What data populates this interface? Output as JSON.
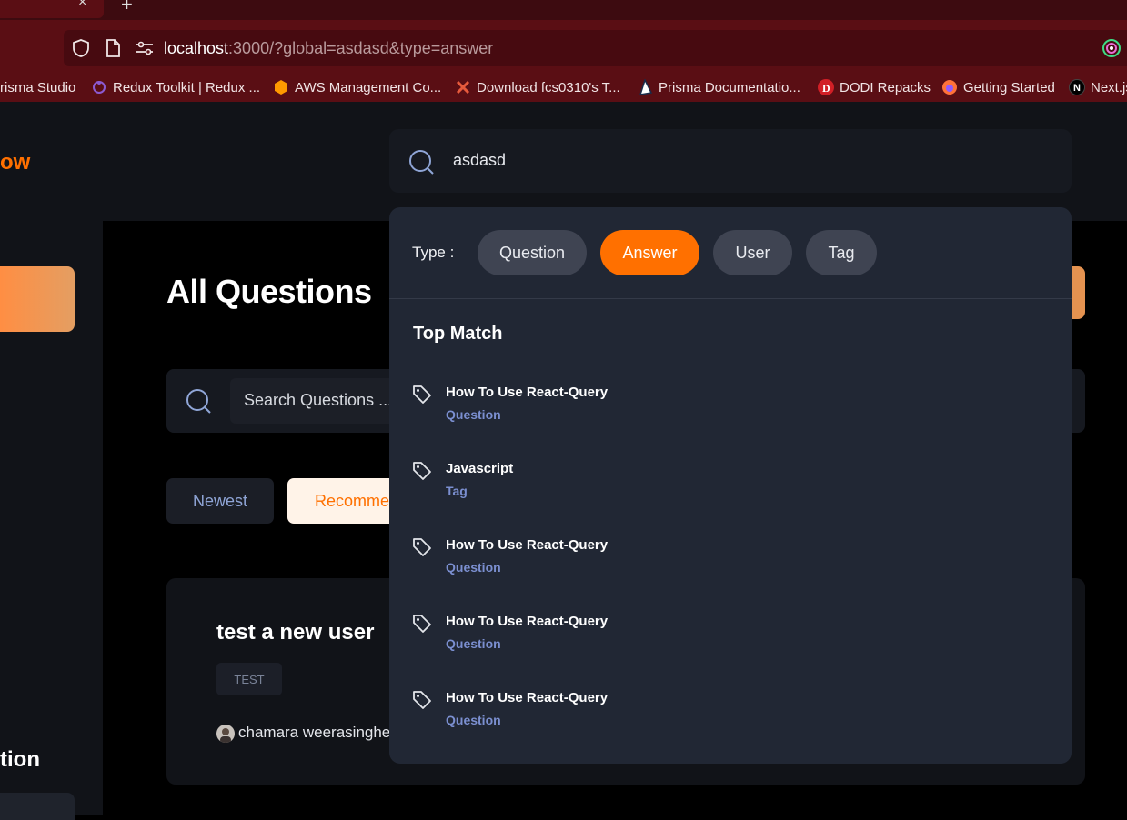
{
  "browser": {
    "tab_close": "×",
    "tab_new": "+",
    "url_host": "localhost",
    "url_rest": ":3000/?global=asdasd&type=answer",
    "bookmarks": [
      {
        "label": "risma Studio",
        "icon": "prisma-icon"
      },
      {
        "label": "Redux Toolkit | Redux ...",
        "icon": "redux-icon"
      },
      {
        "label": "AWS Management Co...",
        "icon": "aws-icon"
      },
      {
        "label": "Download fcs0310's T...",
        "icon": "x-icon"
      },
      {
        "label": "Prisma Documentatio...",
        "icon": "prisma-triangle-icon"
      },
      {
        "label": "DODI Repacks",
        "icon": "dodi-icon"
      },
      {
        "label": "Getting Started",
        "icon": "firefox-icon"
      },
      {
        "label": "Next.js",
        "icon": "nextjs-icon"
      }
    ]
  },
  "header": {
    "logo_fragment": "ow",
    "global_search_value": "asdasd"
  },
  "sidebar": {
    "bottom_fragment": "tion"
  },
  "main": {
    "title": "All Questions",
    "search_placeholder": "Search Questions ...",
    "filters": [
      "Newest",
      "Recommended"
    ],
    "question": {
      "title": "test a new user",
      "tag": "TEST",
      "author": "chamara weerasinghe"
    }
  },
  "dropdown": {
    "type_label": "Type :",
    "types": [
      {
        "label": "Question",
        "active": false
      },
      {
        "label": "Answer",
        "active": true
      },
      {
        "label": "User",
        "active": false
      },
      {
        "label": "Tag",
        "active": false
      }
    ],
    "heading": "Top Match",
    "results": [
      {
        "title": "How To Use React-Query",
        "type": "Question"
      },
      {
        "title": "Javascript",
        "type": "Tag"
      },
      {
        "title": "How To Use React-Query",
        "type": "Question"
      },
      {
        "title": "How To Use React-Query",
        "type": "Question"
      },
      {
        "title": "How To Use React-Query",
        "type": "Question"
      }
    ]
  },
  "colors": {
    "accent": "#ff7000",
    "browser_chrome": "#5a0e14",
    "dropdown_bg": "#212734"
  }
}
